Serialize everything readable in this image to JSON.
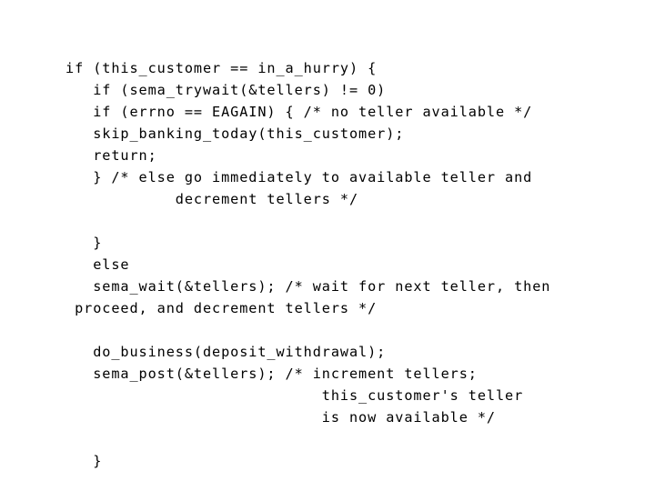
{
  "slide": {
    "background_color": "#ffffff",
    "text_color": "#000000",
    "language": "c",
    "code_lines": [
      "if (this_customer == in_a_hurry) {",
      "   if (sema_trywait(&tellers) != 0)",
      "   if (errno == EAGAIN) { /* no teller available */",
      "   skip_banking_today(this_customer);",
      "   return;",
      "   } /* else go immediately to available teller and",
      "            decrement tellers */",
      "",
      "   }",
      "   else",
      "   sema_wait(&tellers); /* wait for next teller, then",
      " proceed, and decrement tellers */",
      "",
      "   do_business(deposit_withdrawal);",
      "   sema_post(&tellers); /* increment tellers;",
      "                            this_customer's teller",
      "                            is now available */",
      "",
      "   }"
    ]
  }
}
